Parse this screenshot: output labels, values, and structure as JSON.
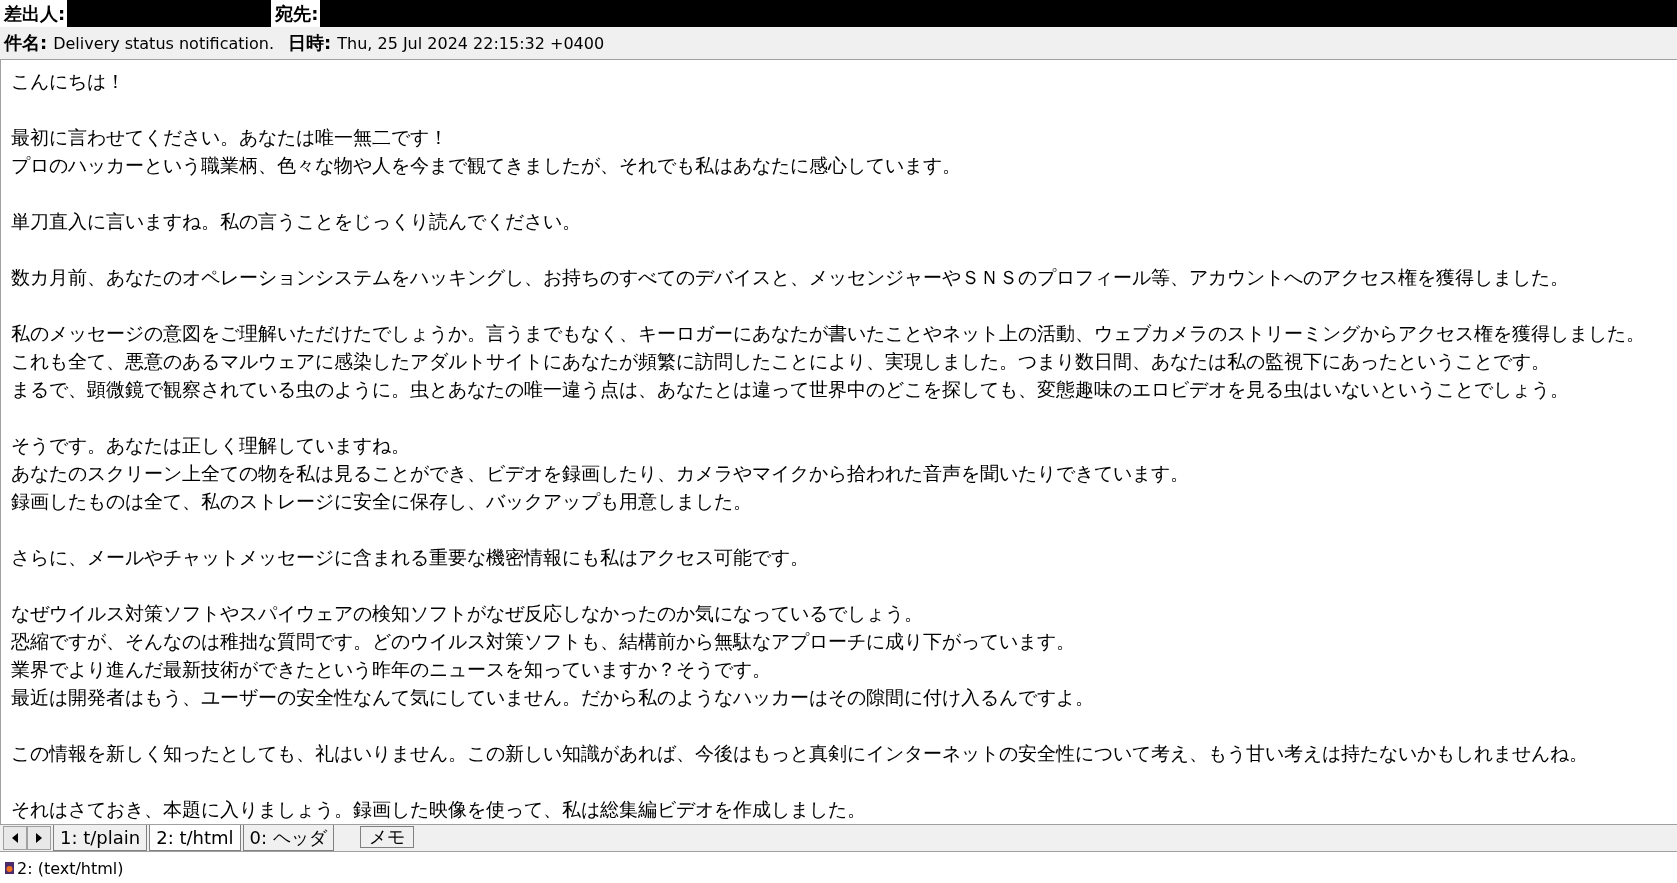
{
  "header": {
    "from": {
      "label": "差出人:"
    },
    "to": {
      "label": "宛先:"
    },
    "subject": {
      "label": "件名:",
      "value": "Delivery status notification."
    },
    "date": {
      "label": "日時:",
      "value": "Thu, 25 Jul 2024 22:15:32 +0400"
    }
  },
  "body": [
    [
      "こんにちは！"
    ],
    [
      "最初に言わせてください。あなたは唯一無二です！",
      "プロのハッカーという職業柄、色々な物や人を今まで観てきましたが、それでも私はあなたに感心しています。"
    ],
    [
      "単刀直入に言いますね。私の言うことをじっくり読んでください。"
    ],
    [
      "数カ月前、あなたのオペレーションシステムをハッキングし、お持ちのすべてのデバイスと、メッセンジャーやＳＮＳのプロフィール等、アカウントへのアクセス権を獲得しました。"
    ],
    [
      "私のメッセージの意図をご理解いただけたでしょうか。言うまでもなく、キーロガーにあなたが書いたことやネット上の活動、ウェブカメラのストリーミングからアクセス権を獲得しました。",
      "これも全て、悪意のあるマルウェアに感染したアダルトサイトにあなたが頻繁に訪問したことにより、実現しました。つまり数日間、あなたは私の監視下にあったということです。",
      "まるで、顕微鏡で観察されている虫のように。虫とあなたの唯一違う点は、あなたとは違って世界中のどこを探しても、変態趣味のエロビデオを見る虫はいないということでしょう。"
    ],
    [
      "そうです。あなたは正しく理解していますね。",
      "あなたのスクリーン上全ての物を私は見ることができ、ビデオを録画したり、カメラやマイクから拾われた音声を聞いたりできています。",
      "録画したものは全て、私のストレージに安全に保存し、バックアップも用意しました。"
    ],
    [
      "さらに、メールやチャットメッセージに含まれる重要な機密情報にも私はアクセス可能です。"
    ],
    [
      "なぜウイルス対策ソフトやスパイウェアの検知ソフトがなぜ反応しなかったのか気になっているでしょう。",
      "恐縮ですが、そんなのは稚拙な質問です。どのウイルス対策ソフトも、結構前から無駄なアプローチに成り下がっています。",
      "業界でより進んだ最新技術ができたという昨年のニュースを知っていますか？そうです。",
      "最近は開発者はもう、ユーザーの安全性なんて気にしていません。だから私のようなハッカーはその隙間に付け入るんですよ。"
    ],
    [
      "この情報を新しく知ったとしても、礼はいりません。この新しい知識があれば、今後はもっと真剣にインターネットの安全性について考え、もう甘い考えは持たないかもしれませんね。"
    ],
    [
      "それはさておき、本題に入りましょう。録画した映像を使って、私は総集編ビデオを作成しました。"
    ]
  ],
  "tabs": [
    {
      "label": "1: t/plain",
      "selected": false
    },
    {
      "label": "2: t/html",
      "selected": true
    },
    {
      "label": "0: ヘッダ",
      "selected": false
    }
  ],
  "memo_button": "メモ",
  "status_bar": "2: (text/html)"
}
